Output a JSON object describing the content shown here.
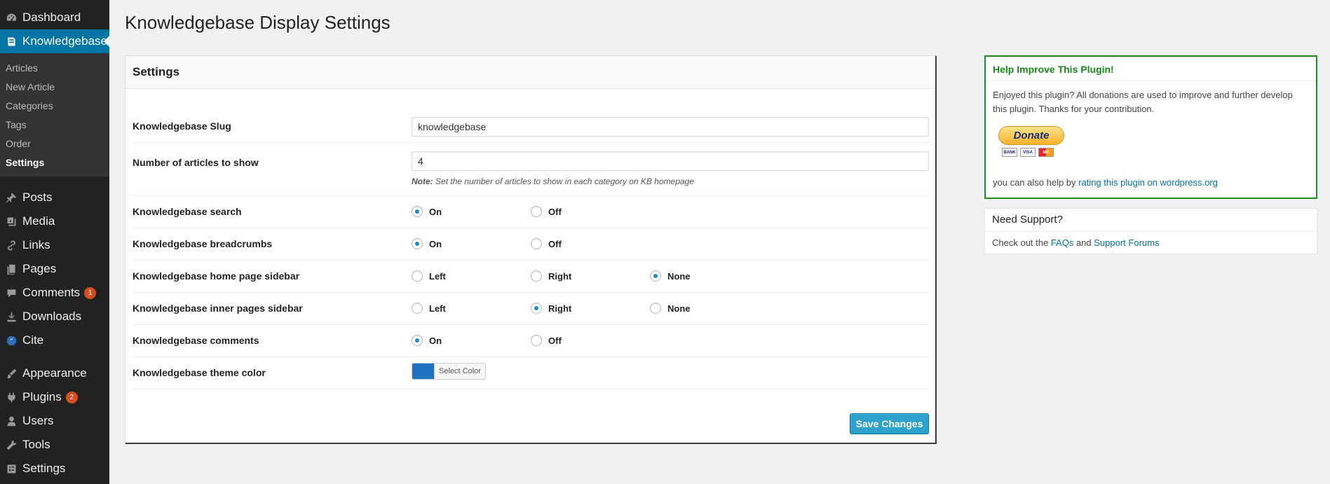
{
  "sidebar": {
    "top_items": [
      {
        "label": "Dashboard",
        "icon": "dashboard-icon"
      },
      {
        "label": "Knowledgebase",
        "icon": "book-icon"
      }
    ],
    "submenu": [
      "Articles",
      "New Article",
      "Categories",
      "Tags",
      "Order",
      "Settings"
    ],
    "items": [
      {
        "label": "Posts",
        "icon": "pin-icon"
      },
      {
        "label": "Media",
        "icon": "media-icon"
      },
      {
        "label": "Links",
        "icon": "link-icon"
      },
      {
        "label": "Pages",
        "icon": "pages-icon"
      },
      {
        "label": "Comments",
        "icon": "comment-icon",
        "badge": "1"
      },
      {
        "label": "Downloads",
        "icon": "download-icon"
      },
      {
        "label": "Cite",
        "icon": "quote-icon"
      },
      {
        "label": "Appearance",
        "icon": "brush-icon"
      },
      {
        "label": "Plugins",
        "icon": "plugin-icon",
        "badge": "2"
      },
      {
        "label": "Users",
        "icon": "user-icon"
      },
      {
        "label": "Tools",
        "icon": "wrench-icon"
      },
      {
        "label": "Settings",
        "icon": "settings-icon"
      }
    ]
  },
  "page": {
    "title": "Knowledgebase Display Settings"
  },
  "settings": {
    "heading": "Settings",
    "slug": {
      "label": "Knowledgebase Slug",
      "value": "knowledgebase"
    },
    "articles": {
      "label": "Number of articles to show",
      "value": "4",
      "note_prefix": "Note:",
      "note_text": "Set the number of articles to show in each category on KB homepage"
    },
    "search": {
      "label": "Knowledgebase search",
      "options": [
        "On",
        "Off"
      ],
      "selected": "On"
    },
    "breadcrumbs": {
      "label": "Knowledgebase breadcrumbs",
      "options": [
        "On",
        "Off"
      ],
      "selected": "On"
    },
    "home_sidebar": {
      "label": "Knowledgebase home page sidebar",
      "options": [
        "Left",
        "Right",
        "None"
      ],
      "selected": "None"
    },
    "inner_sidebar": {
      "label": "Knowledgebase inner pages sidebar",
      "options": [
        "Left",
        "Right",
        "None"
      ],
      "selected": "Right"
    },
    "comments": {
      "label": "Knowledgebase comments",
      "options": [
        "On",
        "Off"
      ],
      "selected": "On"
    },
    "theme_color": {
      "label": "Knowledgebase theme color",
      "button": "Select Color",
      "color": "#1e73be"
    },
    "save_label": "Save Changes"
  },
  "help": {
    "title": "Help Improve This Plugin!",
    "text": "Enjoyed this plugin? All donations are used to improve and further develop this plugin. Thanks for your contribution.",
    "donate_label": "Donate",
    "cards": [
      "BANK",
      "VISA",
      "MC"
    ],
    "foot_prefix": "you can also help by ",
    "foot_link": "rating this plugin on wordpress.org"
  },
  "support": {
    "title": "Need Support?",
    "prefix": "Check out the ",
    "faq_link": "FAQs",
    "and": " and ",
    "forum_link": "Support Forums"
  },
  "colors": {
    "accent": "#0074a2",
    "help_border": "#1d8c1d",
    "radio_dot": "#1e8cbe"
  }
}
